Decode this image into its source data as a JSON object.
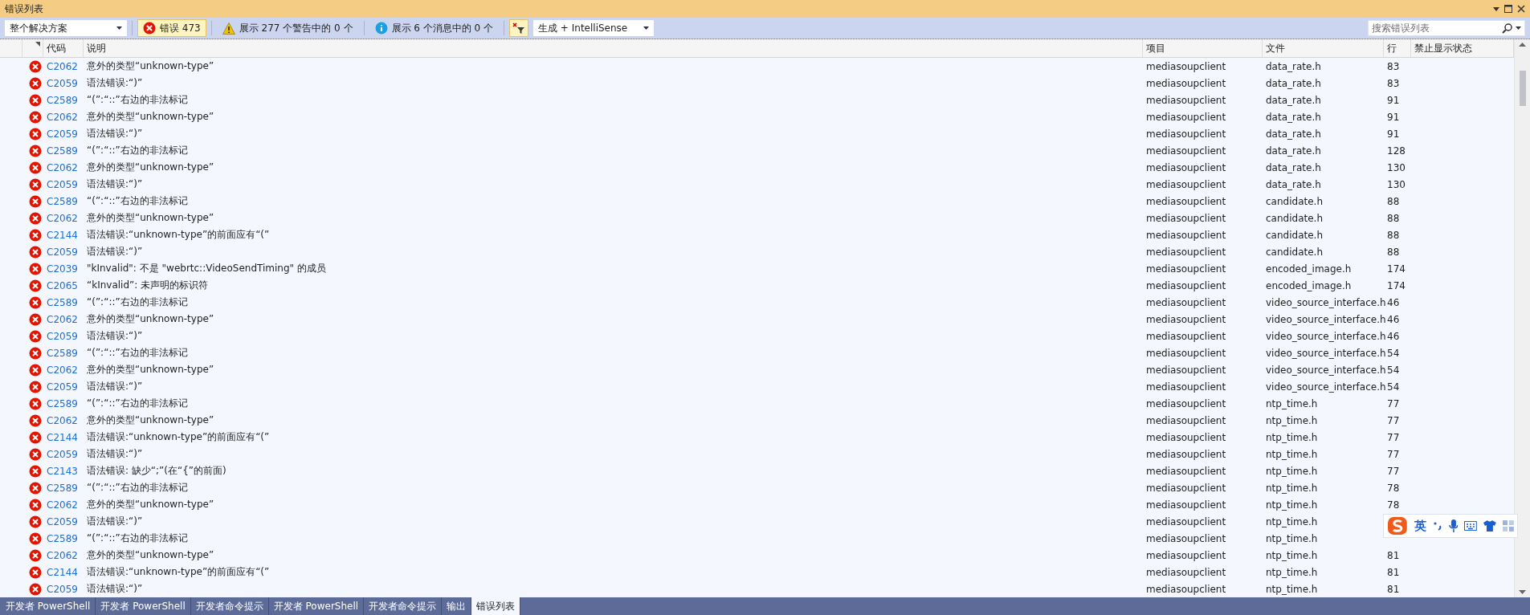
{
  "window": {
    "title": "错误列表"
  },
  "toolbar": {
    "scope": "整个解决方案",
    "filters": [
      {
        "kind": "error",
        "label": "错误 473",
        "selected": true
      },
      {
        "kind": "warning",
        "label": "展示 277 个警告中的 0 个",
        "selected": false
      },
      {
        "kind": "info",
        "label": "展示 6 个消息中的 0 个",
        "selected": false
      }
    ],
    "filter_toggle": {
      "selected": true
    },
    "source": "生成 + IntelliSense",
    "search": {
      "placeholder": "搜索错误列表"
    }
  },
  "table": {
    "columns": [
      "代码",
      "说明",
      "项目",
      "文件",
      "行",
      "禁止显示状态"
    ],
    "rows": [
      {
        "kind": "error",
        "code": "C2062",
        "description": "意外的类型“unknown-type”",
        "project": "mediasoupclient",
        "file": "data_rate.h",
        "line": "83"
      },
      {
        "kind": "error",
        "code": "C2059",
        "description": "语法错误:“)”",
        "project": "mediasoupclient",
        "file": "data_rate.h",
        "line": "83"
      },
      {
        "kind": "error",
        "code": "C2589",
        "description": "“(”:“::”右边的非法标记",
        "project": "mediasoupclient",
        "file": "data_rate.h",
        "line": "91"
      },
      {
        "kind": "error",
        "code": "C2062",
        "description": "意外的类型“unknown-type”",
        "project": "mediasoupclient",
        "file": "data_rate.h",
        "line": "91"
      },
      {
        "kind": "error",
        "code": "C2059",
        "description": "语法错误:“)”",
        "project": "mediasoupclient",
        "file": "data_rate.h",
        "line": "91"
      },
      {
        "kind": "error",
        "code": "C2589",
        "description": "“(”:“::”右边的非法标记",
        "project": "mediasoupclient",
        "file": "data_rate.h",
        "line": "128"
      },
      {
        "kind": "error",
        "code": "C2062",
        "description": "意外的类型“unknown-type”",
        "project": "mediasoupclient",
        "file": "data_rate.h",
        "line": "130"
      },
      {
        "kind": "error",
        "code": "C2059",
        "description": "语法错误:“)”",
        "project": "mediasoupclient",
        "file": "data_rate.h",
        "line": "130"
      },
      {
        "kind": "error",
        "code": "C2589",
        "description": "“(”:“::”右边的非法标记",
        "project": "mediasoupclient",
        "file": "candidate.h",
        "line": "88"
      },
      {
        "kind": "error",
        "code": "C2062",
        "description": "意外的类型“unknown-type”",
        "project": "mediasoupclient",
        "file": "candidate.h",
        "line": "88"
      },
      {
        "kind": "error",
        "code": "C2144",
        "description": "语法错误:“unknown-type”的前面应有“(”",
        "project": "mediasoupclient",
        "file": "candidate.h",
        "line": "88"
      },
      {
        "kind": "error",
        "code": "C2059",
        "description": "语法错误:“)”",
        "project": "mediasoupclient",
        "file": "candidate.h",
        "line": "88"
      },
      {
        "kind": "error",
        "code": "C2039",
        "description": "\"kInvalid\": 不是 \"webrtc::VideoSendTiming\" 的成员",
        "project": "mediasoupclient",
        "file": "encoded_image.h",
        "line": "174"
      },
      {
        "kind": "error",
        "code": "C2065",
        "description": "“kInvalid”: 未声明的标识符",
        "project": "mediasoupclient",
        "file": "encoded_image.h",
        "line": "174"
      },
      {
        "kind": "error",
        "code": "C2589",
        "description": "“(”:“::”右边的非法标记",
        "project": "mediasoupclient",
        "file": "video_source_interface.h",
        "line": "46"
      },
      {
        "kind": "error",
        "code": "C2062",
        "description": "意外的类型“unknown-type”",
        "project": "mediasoupclient",
        "file": "video_source_interface.h",
        "line": "46"
      },
      {
        "kind": "error",
        "code": "C2059",
        "description": "语法错误:“)”",
        "project": "mediasoupclient",
        "file": "video_source_interface.h",
        "line": "46"
      },
      {
        "kind": "error",
        "code": "C2589",
        "description": "“(”:“::”右边的非法标记",
        "project": "mediasoupclient",
        "file": "video_source_interface.h",
        "line": "54"
      },
      {
        "kind": "error",
        "code": "C2062",
        "description": "意外的类型“unknown-type”",
        "project": "mediasoupclient",
        "file": "video_source_interface.h",
        "line": "54"
      },
      {
        "kind": "error",
        "code": "C2059",
        "description": "语法错误:“)”",
        "project": "mediasoupclient",
        "file": "video_source_interface.h",
        "line": "54"
      },
      {
        "kind": "error",
        "code": "C2589",
        "description": "“(”:“::”右边的非法标记",
        "project": "mediasoupclient",
        "file": "ntp_time.h",
        "line": "77"
      },
      {
        "kind": "error",
        "code": "C2062",
        "description": "意外的类型“unknown-type”",
        "project": "mediasoupclient",
        "file": "ntp_time.h",
        "line": "77"
      },
      {
        "kind": "error",
        "code": "C2144",
        "description": "语法错误:“unknown-type”的前面应有“(”",
        "project": "mediasoupclient",
        "file": "ntp_time.h",
        "line": "77"
      },
      {
        "kind": "error",
        "code": "C2059",
        "description": "语法错误:“)”",
        "project": "mediasoupclient",
        "file": "ntp_time.h",
        "line": "77"
      },
      {
        "kind": "error",
        "code": "C2143",
        "description": "语法错误: 缺少“;”(在“{”的前面)",
        "project": "mediasoupclient",
        "file": "ntp_time.h",
        "line": "77"
      },
      {
        "kind": "error",
        "code": "C2589",
        "description": "“(”:“::”右边的非法标记",
        "project": "mediasoupclient",
        "file": "ntp_time.h",
        "line": "78"
      },
      {
        "kind": "error",
        "code": "C2062",
        "description": "意外的类型“unknown-type”",
        "project": "mediasoupclient",
        "file": "ntp_time.h",
        "line": "78"
      },
      {
        "kind": "error",
        "code": "C2059",
        "description": "语法错误:“)”",
        "project": "mediasoupclient",
        "file": "ntp_time.h"
      },
      {
        "kind": "error",
        "code": "C2589",
        "description": "“(”:“::”右边的非法标记",
        "project": "mediasoupclient",
        "file": "ntp_time.h"
      },
      {
        "kind": "error",
        "code": "C2062",
        "description": "意外的类型“unknown-type”",
        "project": "mediasoupclient",
        "file": "ntp_time.h",
        "line": "81"
      },
      {
        "kind": "error",
        "code": "C2144",
        "description": "语法错误:“unknown-type”的前面应有“(”",
        "project": "mediasoupclient",
        "file": "ntp_time.h",
        "line": "81"
      },
      {
        "kind": "error",
        "code": "C2059",
        "description": "语法错误:“)”",
        "project": "mediasoupclient",
        "file": "ntp_time.h",
        "line": "81"
      }
    ]
  },
  "bottom_tabs": [
    {
      "label": "开发者 PowerShell",
      "selected": false
    },
    {
      "label": "开发者 PowerShell",
      "selected": false
    },
    {
      "label": "开发者命令提示",
      "selected": false
    },
    {
      "label": "开发者 PowerShell",
      "selected": false
    },
    {
      "label": "开发者命令提示",
      "selected": false
    },
    {
      "label": "输出",
      "selected": false
    },
    {
      "label": "错误列表",
      "selected": true
    }
  ],
  "ime_bar": {
    "mode": "英"
  }
}
